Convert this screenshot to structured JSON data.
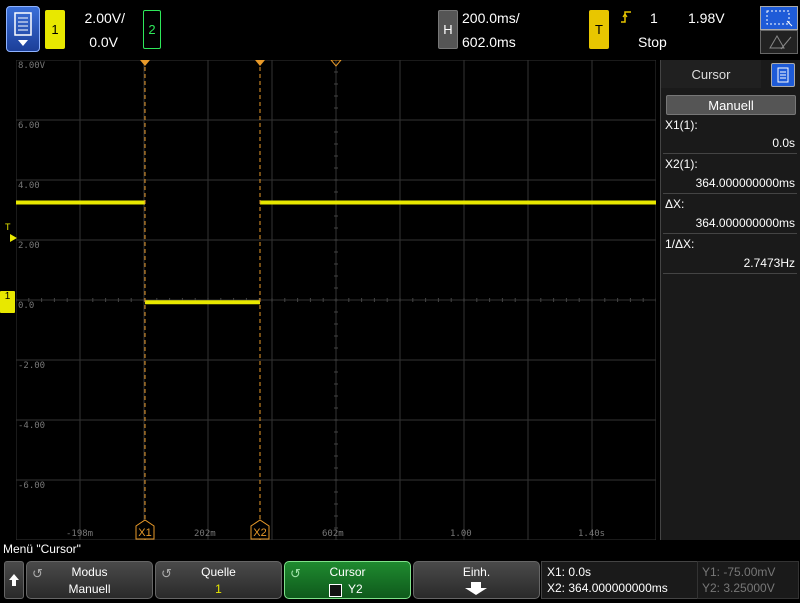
{
  "top": {
    "ch1_label": "1",
    "ch1_scale": "2.00V/",
    "ch1_offset": "0.0V",
    "ch2_label": "2",
    "h_label": "H",
    "time_scale": "200.0ms/",
    "time_delay": "602.0ms",
    "t_label": "T",
    "trigger_source": "1",
    "trigger_level": "1.98V",
    "run_state": "Stop"
  },
  "plot": {
    "v_labels": [
      "8.00V",
      "6.00",
      "4.00",
      "2.00",
      "0.0",
      "-2.00",
      "-4.00",
      "-6.00"
    ],
    "t_labels": [
      "-198m",
      "202m",
      "602m",
      "1.00",
      "1.40s"
    ],
    "cursor_x1": "X1",
    "cursor_x2": "X2",
    "trigger_marker": "T",
    "ground_marker": "1"
  },
  "panel": {
    "title": "Cursor",
    "mode": "Manuell",
    "x1_label": "X1(1):",
    "x1_value": "0.0s",
    "x2_label": "X2(1):",
    "x2_value": "364.000000000ms",
    "dx_label": "ΔX:",
    "dx_value": "364.000000000ms",
    "inv_dx_label": "1/ΔX:",
    "inv_dx_value": "2.7473Hz"
  },
  "menu_title": "Menü \"Cursor\"",
  "softkeys": {
    "modus_title": "Modus",
    "modus_value": "Manuell",
    "quelle_title": "Quelle",
    "quelle_value": "1",
    "cursor_title": "Cursor",
    "cursor_value": "Y2",
    "einh_title": "Einh."
  },
  "readout": {
    "x1": "X1:  0.0s",
    "x2": "X2:  364.000000000ms",
    "y1": "Y1: -75.00mV",
    "y2": "Y2: 3.25000V"
  },
  "colors": {
    "ch1": "#e8e800",
    "ch2": "#2ee85a",
    "cursor": "#e89a2a",
    "accent_blue": "#1e5bd8"
  }
}
